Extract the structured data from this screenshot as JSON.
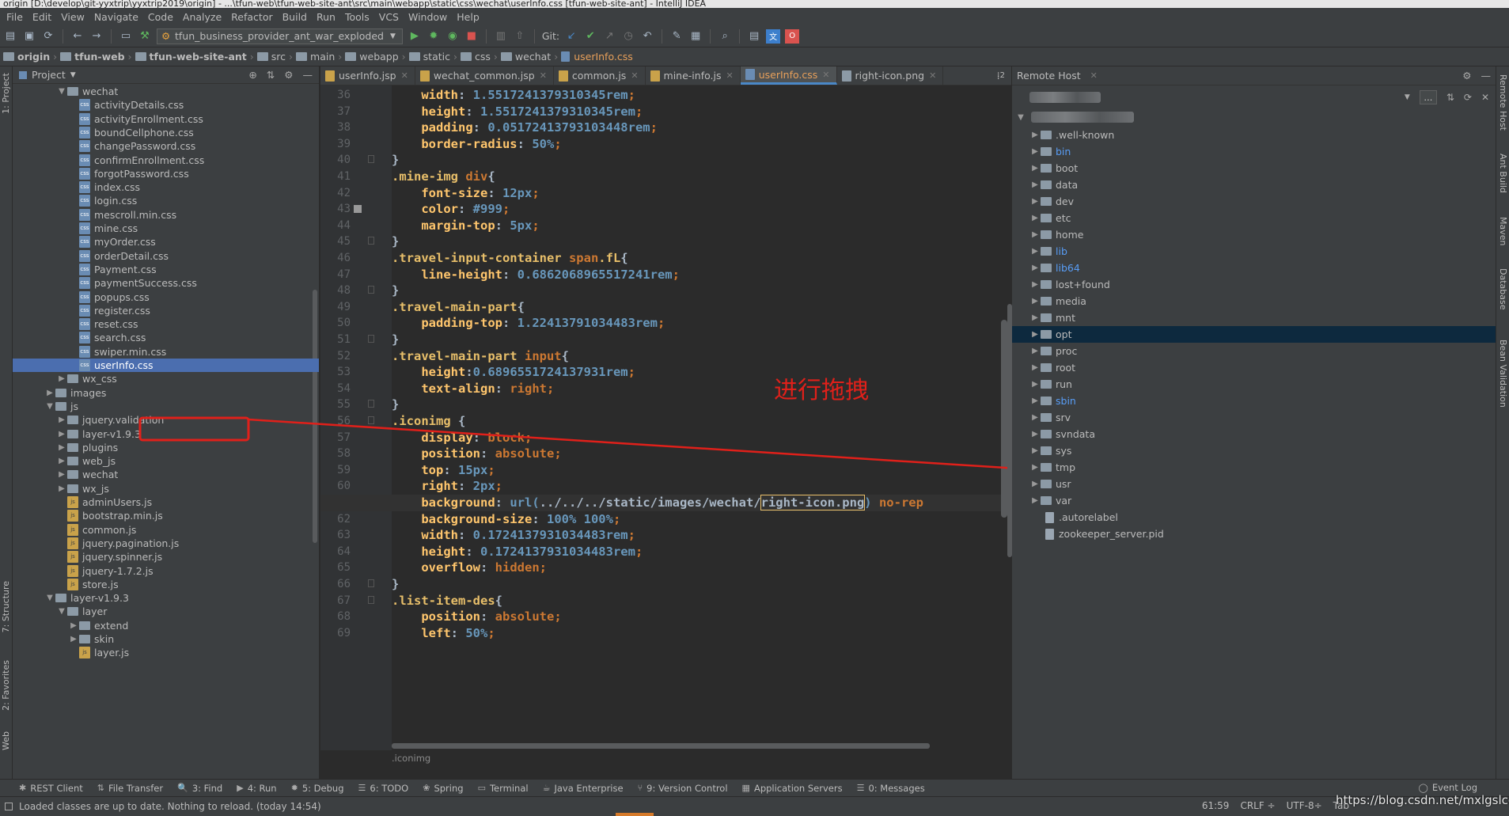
{
  "window": {
    "title": "origin [D:\\develop\\git-yyxtrip\\yyxtrip2019\\origin] - ...\\tfun-web\\tfun-web-site-ant\\src\\main\\webapp\\static\\css\\wechat\\userInfo.css [tfun-web-site-ant] - IntelliJ IDEA"
  },
  "menu": [
    "File",
    "Edit",
    "View",
    "Navigate",
    "Code",
    "Analyze",
    "Refactor",
    "Build",
    "Run",
    "Tools",
    "VCS",
    "Window",
    "Help"
  ],
  "toolbar": {
    "run_config": "tfun_business_provider_ant_war_exploded",
    "git_label": "Git:"
  },
  "breadcrumb": [
    "origin",
    "tfun-web",
    "tfun-web-site-ant",
    "src",
    "main",
    "webapp",
    "static",
    "css",
    "wechat",
    "userInfo.css"
  ],
  "project_panel": {
    "title": "Project",
    "tree": [
      {
        "label": "wechat",
        "type": "folder",
        "depth": 3,
        "expanded": true
      },
      {
        "label": "activityDetails.css",
        "type": "css",
        "depth": 4
      },
      {
        "label": "activityEnrollment.css",
        "type": "css",
        "depth": 4
      },
      {
        "label": "boundCellphone.css",
        "type": "css",
        "depth": 4
      },
      {
        "label": "changePassword.css",
        "type": "css",
        "depth": 4
      },
      {
        "label": "confirmEnrollment.css",
        "type": "css",
        "depth": 4
      },
      {
        "label": "forgotPassword.css",
        "type": "css",
        "depth": 4
      },
      {
        "label": "index.css",
        "type": "css",
        "depth": 4
      },
      {
        "label": "login.css",
        "type": "css",
        "depth": 4
      },
      {
        "label": "mescroll.min.css",
        "type": "css",
        "depth": 4
      },
      {
        "label": "mine.css",
        "type": "css",
        "depth": 4
      },
      {
        "label": "myOrder.css",
        "type": "css",
        "depth": 4
      },
      {
        "label": "orderDetail.css",
        "type": "css",
        "depth": 4
      },
      {
        "label": "Payment.css",
        "type": "css",
        "depth": 4
      },
      {
        "label": "paymentSuccess.css",
        "type": "css",
        "depth": 4
      },
      {
        "label": "popups.css",
        "type": "css",
        "depth": 4
      },
      {
        "label": "register.css",
        "type": "css",
        "depth": 4
      },
      {
        "label": "reset.css",
        "type": "css",
        "depth": 4
      },
      {
        "label": "search.css",
        "type": "css",
        "depth": 4
      },
      {
        "label": "swiper.min.css",
        "type": "css",
        "depth": 4
      },
      {
        "label": "userInfo.css",
        "type": "css",
        "depth": 4,
        "selected": true
      },
      {
        "label": "wx_css",
        "type": "folder",
        "depth": 3,
        "expanded": false
      },
      {
        "label": "images",
        "type": "folder",
        "depth": 2,
        "expanded": false
      },
      {
        "label": "js",
        "type": "folder",
        "depth": 2,
        "expanded": true
      },
      {
        "label": "jquery.validation",
        "type": "folder",
        "depth": 3,
        "expanded": false
      },
      {
        "label": "layer-v1.9.3",
        "type": "folder",
        "depth": 3,
        "expanded": false
      },
      {
        "label": "plugins",
        "type": "folder",
        "depth": 3,
        "expanded": false
      },
      {
        "label": "web_js",
        "type": "folder",
        "depth": 3,
        "expanded": false
      },
      {
        "label": "wechat",
        "type": "folder",
        "depth": 3,
        "expanded": false
      },
      {
        "label": "wx_js",
        "type": "folder",
        "depth": 3,
        "expanded": false
      },
      {
        "label": "adminUsers.js",
        "type": "js",
        "depth": 3
      },
      {
        "label": "bootstrap.min.js",
        "type": "js",
        "depth": 3
      },
      {
        "label": "common.js",
        "type": "js",
        "depth": 3
      },
      {
        "label": "jquery.pagination.js",
        "type": "js",
        "depth": 3
      },
      {
        "label": "jquery.spinner.js",
        "type": "js",
        "depth": 3
      },
      {
        "label": "jquery-1.7.2.js",
        "type": "js",
        "depth": 3
      },
      {
        "label": "store.js",
        "type": "js",
        "depth": 3
      },
      {
        "label": "layer-v1.9.3",
        "type": "folder",
        "depth": 2,
        "expanded": true
      },
      {
        "label": "layer",
        "type": "folder",
        "depth": 3,
        "expanded": true
      },
      {
        "label": "extend",
        "type": "folder",
        "depth": 4,
        "expanded": false
      },
      {
        "label": "skin",
        "type": "folder",
        "depth": 4,
        "expanded": false
      },
      {
        "label": "layer.js",
        "type": "js",
        "depth": 4
      }
    ]
  },
  "editor": {
    "tabs": [
      {
        "label": "userInfo.jsp",
        "color": "#c9a24a",
        "active": false
      },
      {
        "label": "wechat_common.jsp",
        "color": "#c9a24a",
        "active": false
      },
      {
        "label": "common.js",
        "color": "#c9a24a",
        "active": false
      },
      {
        "label": "mine-info.js",
        "color": "#c9a24a",
        "active": false
      },
      {
        "label": "userInfo.css",
        "color": "#6a8cb3",
        "active": true
      },
      {
        "label": "right-icon.png",
        "color": "#8c9aa6",
        "active": false
      }
    ],
    "tab_overflow": "2",
    "current_line": 61,
    "lines": [
      {
        "n": 36,
        "parts": [
          [
            "tok-prop",
            "    width"
          ],
          [
            "tok-fn",
            ": "
          ],
          [
            "tok-num",
            "1.5517241379310345rem"
          ],
          [
            "tok-punct",
            ";"
          ]
        ]
      },
      {
        "n": 37,
        "parts": [
          [
            "tok-prop",
            "    height"
          ],
          [
            "tok-fn",
            ": "
          ],
          [
            "tok-num",
            "1.5517241379310345rem"
          ],
          [
            "tok-punct",
            ";"
          ]
        ]
      },
      {
        "n": 38,
        "parts": [
          [
            "tok-prop",
            "    padding"
          ],
          [
            "tok-fn",
            ": "
          ],
          [
            "tok-num",
            "0.05172413793103448rem"
          ],
          [
            "tok-punct",
            ";"
          ]
        ]
      },
      {
        "n": 39,
        "parts": [
          [
            "tok-prop",
            "    border-radius"
          ],
          [
            "tok-fn",
            ": "
          ],
          [
            "tok-num",
            "50%"
          ],
          [
            "tok-punct",
            ";"
          ]
        ]
      },
      {
        "n": 40,
        "parts": [
          [
            "tok-fn",
            "}"
          ]
        ]
      },
      {
        "n": 41,
        "parts": [
          [
            "tok-sel",
            ".mine-img "
          ],
          [
            "tok-val",
            "div"
          ],
          [
            "tok-fn",
            "{"
          ]
        ]
      },
      {
        "n": 42,
        "parts": [
          [
            "tok-prop",
            "    font-size"
          ],
          [
            "tok-fn",
            ": "
          ],
          [
            "tok-num",
            "12px"
          ],
          [
            "tok-punct",
            ";"
          ]
        ]
      },
      {
        "n": 43,
        "parts": [
          [
            "tok-prop",
            "    color"
          ],
          [
            "tok-fn",
            ": "
          ],
          [
            "tok-num",
            "#999"
          ],
          [
            "tok-punct",
            ";"
          ]
        ]
      },
      {
        "n": 44,
        "parts": [
          [
            "tok-prop",
            "    margin-top"
          ],
          [
            "tok-fn",
            ": "
          ],
          [
            "tok-num",
            "5px"
          ],
          [
            "tok-punct",
            ";"
          ]
        ]
      },
      {
        "n": 45,
        "parts": [
          [
            "tok-fn",
            "}"
          ]
        ]
      },
      {
        "n": 46,
        "parts": [
          [
            "tok-sel",
            ".travel-input-container "
          ],
          [
            "tok-val",
            "span"
          ],
          [
            "tok-sel",
            ".fL"
          ],
          [
            "tok-fn",
            "{"
          ]
        ]
      },
      {
        "n": 47,
        "parts": [
          [
            "tok-prop",
            "    line-height"
          ],
          [
            "tok-fn",
            ": "
          ],
          [
            "tok-num",
            "0.6862068965517241rem"
          ],
          [
            "tok-punct",
            ";"
          ]
        ]
      },
      {
        "n": 48,
        "parts": [
          [
            "tok-fn",
            "}"
          ]
        ]
      },
      {
        "n": 49,
        "parts": [
          [
            "tok-sel",
            ".travel-main-part"
          ],
          [
            "tok-fn",
            "{"
          ]
        ]
      },
      {
        "n": 50,
        "parts": [
          [
            "tok-prop",
            "    padding-top"
          ],
          [
            "tok-fn",
            ": "
          ],
          [
            "tok-num",
            "1.22413791034483rem"
          ],
          [
            "tok-punct",
            ";"
          ]
        ]
      },
      {
        "n": 51,
        "parts": [
          [
            "tok-fn",
            "}"
          ]
        ]
      },
      {
        "n": 52,
        "parts": [
          [
            "tok-sel",
            ".travel-main-part "
          ],
          [
            "tok-val",
            "input"
          ],
          [
            "tok-fn",
            "{"
          ]
        ]
      },
      {
        "n": 53,
        "parts": [
          [
            "tok-prop",
            "    height"
          ],
          [
            "tok-fn",
            ":"
          ],
          [
            "tok-num",
            "0.6896551724137931rem"
          ],
          [
            "tok-punct",
            ";"
          ]
        ]
      },
      {
        "n": 54,
        "parts": [
          [
            "tok-prop",
            "    text-align"
          ],
          [
            "tok-fn",
            ": "
          ],
          [
            "tok-val",
            "right"
          ],
          [
            "tok-punct",
            ";"
          ]
        ]
      },
      {
        "n": 55,
        "parts": [
          [
            "tok-fn",
            "}"
          ]
        ]
      },
      {
        "n": 56,
        "parts": [
          [
            "tok-sel",
            ".iconimg "
          ],
          [
            "tok-fn",
            "{"
          ]
        ]
      },
      {
        "n": 57,
        "parts": [
          [
            "tok-prop",
            "    display"
          ],
          [
            "tok-fn",
            ": "
          ],
          [
            "tok-val",
            "block"
          ],
          [
            "tok-punct",
            ";"
          ]
        ]
      },
      {
        "n": 58,
        "parts": [
          [
            "tok-prop",
            "    position"
          ],
          [
            "tok-fn",
            ": "
          ],
          [
            "tok-val",
            "absolute"
          ],
          [
            "tok-punct",
            ";"
          ]
        ]
      },
      {
        "n": 59,
        "parts": [
          [
            "tok-prop",
            "    top"
          ],
          [
            "tok-fn",
            ": "
          ],
          [
            "tok-num",
            "15px"
          ],
          [
            "tok-punct",
            ";"
          ]
        ]
      },
      {
        "n": 60,
        "parts": [
          [
            "tok-prop",
            "    right"
          ],
          [
            "tok-fn",
            ": "
          ],
          [
            "tok-num",
            "2px"
          ],
          [
            "tok-punct",
            ";"
          ]
        ]
      },
      {
        "n": 61,
        "parts": [
          [
            "tok-prop",
            "    background"
          ],
          [
            "tok-fn",
            ": "
          ],
          [
            "tok-num",
            "url("
          ],
          [
            "tok-url",
            "../../../static/images/wechat/"
          ],
          [
            "tok-url tok-hl",
            "right-icon.png"
          ],
          [
            "tok-num",
            ")"
          ],
          [
            "tok-val",
            " no-rep"
          ]
        ]
      },
      {
        "n": 62,
        "parts": [
          [
            "tok-prop",
            "    background-size"
          ],
          [
            "tok-fn",
            ": "
          ],
          [
            "tok-num",
            "100% 100%"
          ],
          [
            "tok-punct",
            ";"
          ]
        ]
      },
      {
        "n": 63,
        "parts": [
          [
            "tok-prop",
            "    width"
          ],
          [
            "tok-fn",
            ": "
          ],
          [
            "tok-num",
            "0.1724137931034483rem"
          ],
          [
            "tok-punct",
            ";"
          ]
        ]
      },
      {
        "n": 64,
        "parts": [
          [
            "tok-prop",
            "    height"
          ],
          [
            "tok-fn",
            ": "
          ],
          [
            "tok-num",
            "0.1724137931034483rem"
          ],
          [
            "tok-punct",
            ";"
          ]
        ]
      },
      {
        "n": 65,
        "parts": [
          [
            "tok-prop",
            "    overflow"
          ],
          [
            "tok-fn",
            ": "
          ],
          [
            "tok-val",
            "hidden"
          ],
          [
            "tok-punct",
            ";"
          ]
        ]
      },
      {
        "n": 66,
        "parts": [
          [
            "tok-fn",
            "}"
          ]
        ]
      },
      {
        "n": 67,
        "parts": [
          [
            "tok-sel",
            ".list-item-des"
          ],
          [
            "tok-fn",
            "{"
          ]
        ]
      },
      {
        "n": 68,
        "parts": [
          [
            "tok-prop",
            "    position"
          ],
          [
            "tok-fn",
            ": "
          ],
          [
            "tok-val",
            "absolute"
          ],
          [
            "tok-punct",
            ";"
          ]
        ]
      },
      {
        "n": 69,
        "parts": [
          [
            "tok-prop",
            "    left"
          ],
          [
            "tok-fn",
            ": "
          ],
          [
            "tok-num",
            "50%"
          ],
          [
            "tok-punct",
            ";"
          ]
        ]
      }
    ],
    "footer_breadcrumb": ".iconimg"
  },
  "annotation": {
    "text": "进行拖拽",
    "color": "#e0201a"
  },
  "remote_panel": {
    "title": "Remote Host",
    "entries": [
      {
        "label": ".well-known",
        "type": "folder"
      },
      {
        "label": "bin",
        "type": "folder",
        "link": true
      },
      {
        "label": "boot",
        "type": "folder"
      },
      {
        "label": "data",
        "type": "folder"
      },
      {
        "label": "dev",
        "type": "folder"
      },
      {
        "label": "etc",
        "type": "folder"
      },
      {
        "label": "home",
        "type": "folder"
      },
      {
        "label": "lib",
        "type": "folder",
        "link": true
      },
      {
        "label": "lib64",
        "type": "folder",
        "link": true
      },
      {
        "label": "lost+found",
        "type": "folder"
      },
      {
        "label": "media",
        "type": "folder"
      },
      {
        "label": "mnt",
        "type": "folder"
      },
      {
        "label": "opt",
        "type": "folder",
        "selected": true
      },
      {
        "label": "proc",
        "type": "folder"
      },
      {
        "label": "root",
        "type": "folder"
      },
      {
        "label": "run",
        "type": "folder"
      },
      {
        "label": "sbin",
        "type": "folder",
        "link": true
      },
      {
        "label": "srv",
        "type": "folder"
      },
      {
        "label": "svndata",
        "type": "folder"
      },
      {
        "label": "sys",
        "type": "folder"
      },
      {
        "label": "tmp",
        "type": "folder"
      },
      {
        "label": "usr",
        "type": "folder"
      },
      {
        "label": "var",
        "type": "folder"
      },
      {
        "label": ".autorelabel",
        "type": "file"
      },
      {
        "label": "zookeeper_server.pid",
        "type": "file"
      }
    ]
  },
  "left_stripe": [
    "1: Project",
    "7: Structure",
    "2: Favorites",
    "Web"
  ],
  "right_stripe": [
    "Remote Host",
    "Ant Build",
    "Maven",
    "Database",
    "Bean Validation"
  ],
  "bottom_tools": [
    {
      "label": "REST Client",
      "icon": "✱"
    },
    {
      "label": "File Transfer",
      "icon": "⇅"
    },
    {
      "label": "3: Find",
      "icon": "🔍"
    },
    {
      "label": "4: Run",
      "icon": "▶"
    },
    {
      "label": "5: Debug",
      "icon": "✹"
    },
    {
      "label": "6: TODO",
      "icon": "☰"
    },
    {
      "label": "Spring",
      "icon": "❀"
    },
    {
      "label": "Terminal",
      "icon": "▭"
    },
    {
      "label": "Java Enterprise",
      "icon": "☕"
    },
    {
      "label": "9: Version Control",
      "icon": "⑂"
    },
    {
      "label": "Application Servers",
      "icon": "▦"
    },
    {
      "label": "0: Messages",
      "icon": "☰"
    }
  ],
  "event_log": "Event Log",
  "status": {
    "message": "Loaded classes are up to date. Nothing to reload. (today 14:54)",
    "position": "61:59",
    "line_sep": "CRLF ÷",
    "encoding": "UTF-8÷",
    "indent": "Tab"
  },
  "watermark": "https://blog.csdn.net/mxlgslcd"
}
